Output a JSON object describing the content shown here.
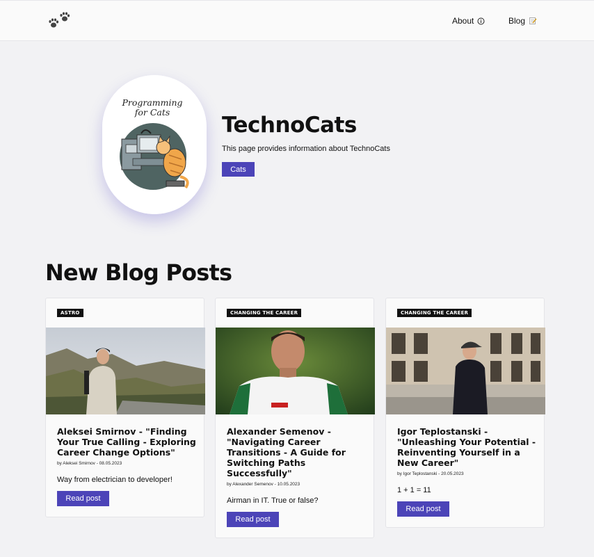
{
  "header": {
    "nav_about": "About",
    "nav_blog": "Blog"
  },
  "hero": {
    "image_text_line1": "Programming",
    "image_text_line2": "for Cats",
    "title": "TechnoCats",
    "description": "This page provides information about TechnoCats",
    "button": "Cats"
  },
  "section_title": "New Blog Posts",
  "posts": [
    {
      "tag": "ASTRO",
      "title": "Aleksei Smirnov - \"Finding Your True Calling - Exploring Career Change Options\"",
      "meta": "by Aleksei Smirnov - 08.05.2023",
      "excerpt": "Way from electrician to developer!",
      "button": "Read post"
    },
    {
      "tag": "CHANGING THE CAREER",
      "title": "Alexander Semenov - \"Navigating Career Transitions - A Guide for Switching Paths Successfully\"",
      "meta": "by Alexander Semenov - 10.05.2023",
      "excerpt": "Airman in IT. True or false?",
      "button": "Read post"
    },
    {
      "tag": "CHANGING THE CAREER",
      "title": "Igor Teplostanski - \"Unleashing Your Potential - Reinventing Yourself in a New Career\"",
      "meta": "by Igor Teplostanski - 20.05.2023",
      "excerpt": "1 + 1 = 11",
      "button": "Read post"
    }
  ],
  "colors": {
    "accent": "#4c44b8",
    "background": "#f2f2f4",
    "tag_bg": "#111111"
  },
  "icons": {
    "logo": "paw-prints-icon",
    "about": "info-icon",
    "blog": "memo-icon"
  }
}
